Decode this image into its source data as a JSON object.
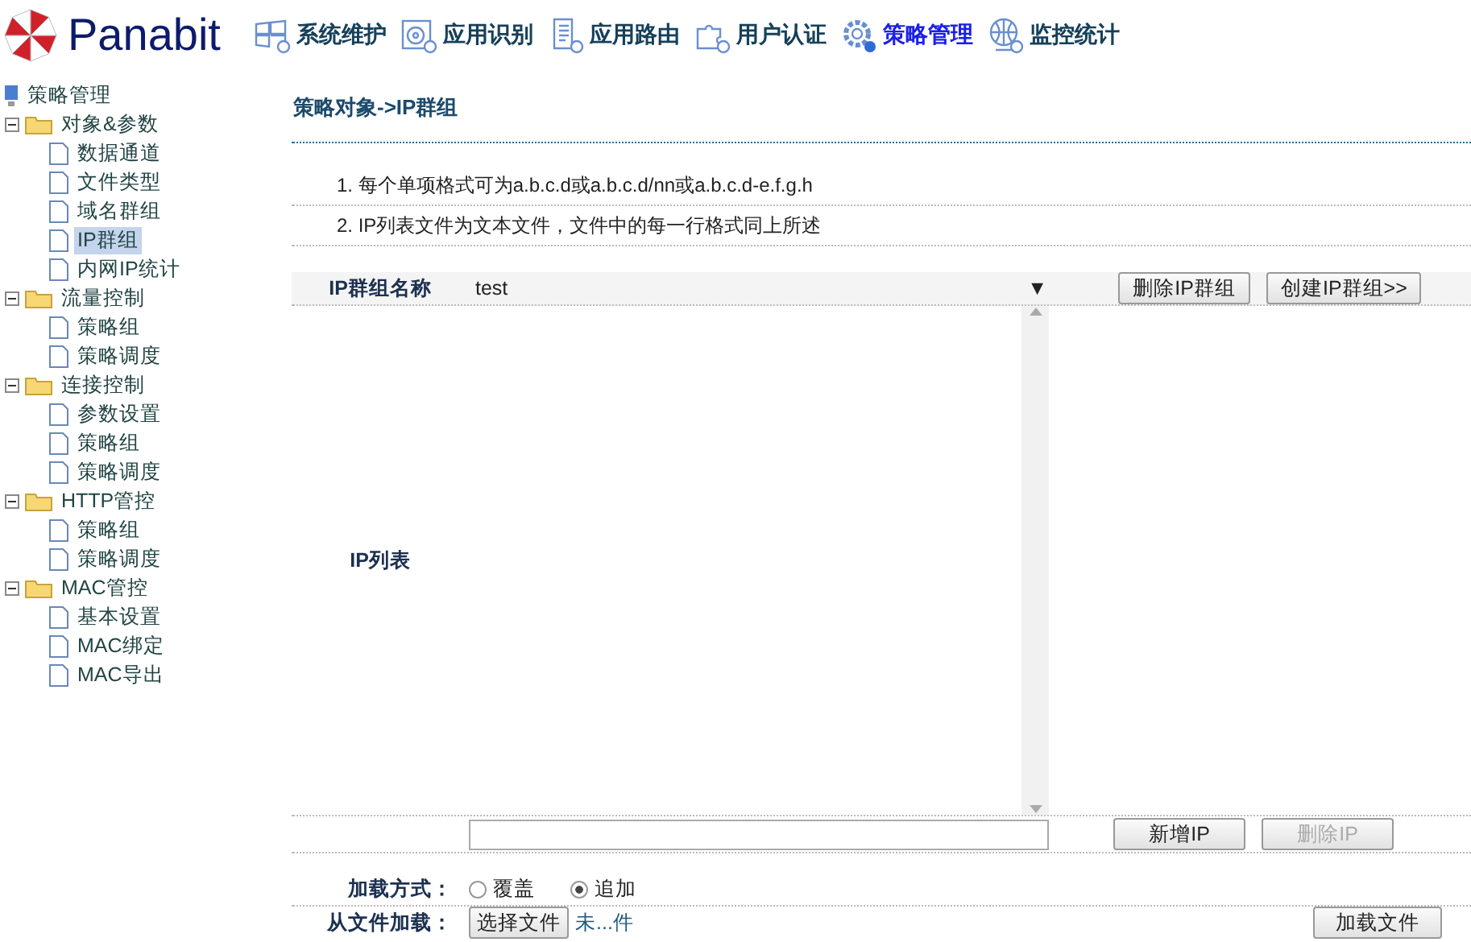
{
  "header": {
    "logo": "Panabit",
    "nav": [
      {
        "label": "系统维护",
        "selected": false
      },
      {
        "label": "应用识别",
        "selected": false
      },
      {
        "label": "应用路由",
        "selected": false
      },
      {
        "label": "用户认证",
        "selected": false
      },
      {
        "label": "策略管理",
        "selected": true
      },
      {
        "label": "监控统计",
        "selected": false
      }
    ]
  },
  "sidebar": {
    "root": "策略管理",
    "items": [
      {
        "label": "对象&参数",
        "expanded": true,
        "children": [
          {
            "label": "数据通道",
            "selected": false
          },
          {
            "label": "文件类型",
            "selected": false
          },
          {
            "label": "域名群组",
            "selected": false
          },
          {
            "label": "IP群组",
            "selected": true
          },
          {
            "label": "内网IP统计",
            "selected": false
          }
        ]
      },
      {
        "label": "流量控制",
        "expanded": true,
        "children": [
          {
            "label": "策略组",
            "selected": false
          },
          {
            "label": "策略调度",
            "selected": false
          }
        ]
      },
      {
        "label": "连接控制",
        "expanded": true,
        "children": [
          {
            "label": "参数设置",
            "selected": false
          },
          {
            "label": "策略组",
            "selected": false
          },
          {
            "label": "策略调度",
            "selected": false
          }
        ]
      },
      {
        "label": "HTTP管控",
        "expanded": true,
        "children": [
          {
            "label": "策略组",
            "selected": false
          },
          {
            "label": "策略调度",
            "selected": false
          }
        ]
      },
      {
        "label": "MAC管控",
        "expanded": true,
        "children": [
          {
            "label": "基本设置",
            "selected": false
          },
          {
            "label": "MAC绑定",
            "selected": false
          },
          {
            "label": "MAC导出",
            "selected": false
          }
        ]
      }
    ]
  },
  "content": {
    "title": "策略对象->IP群组",
    "notes": [
      "1. 每个单项格式可为a.b.c.d或a.b.c.d/nn或a.b.c.d-e.f.g.h",
      "2. IP列表文件为文本文件，文件中的每一行格式同上所述"
    ],
    "group": {
      "label": "IP群组名称",
      "value": "test",
      "arrow": "▼",
      "buttons": [
        {
          "label": "删除IP群组",
          "disabled": false
        },
        {
          "label": "创建IP群组>>",
          "disabled": false
        }
      ]
    },
    "ip_list": {
      "label": "IP列表"
    },
    "add_row": {
      "buttons": [
        {
          "label": "新增IP",
          "disabled": false
        },
        {
          "label": "删除IP",
          "disabled": true
        }
      ]
    },
    "load_mode": {
      "label": "加载方式：",
      "options": [
        {
          "label": "覆盖",
          "selected": false
        },
        {
          "label": "追加",
          "selected": true
        }
      ]
    },
    "file_load": {
      "label": "从文件加载：",
      "choose": "选择文件",
      "file_name": "未...件",
      "submit": "加载文件"
    }
  }
}
